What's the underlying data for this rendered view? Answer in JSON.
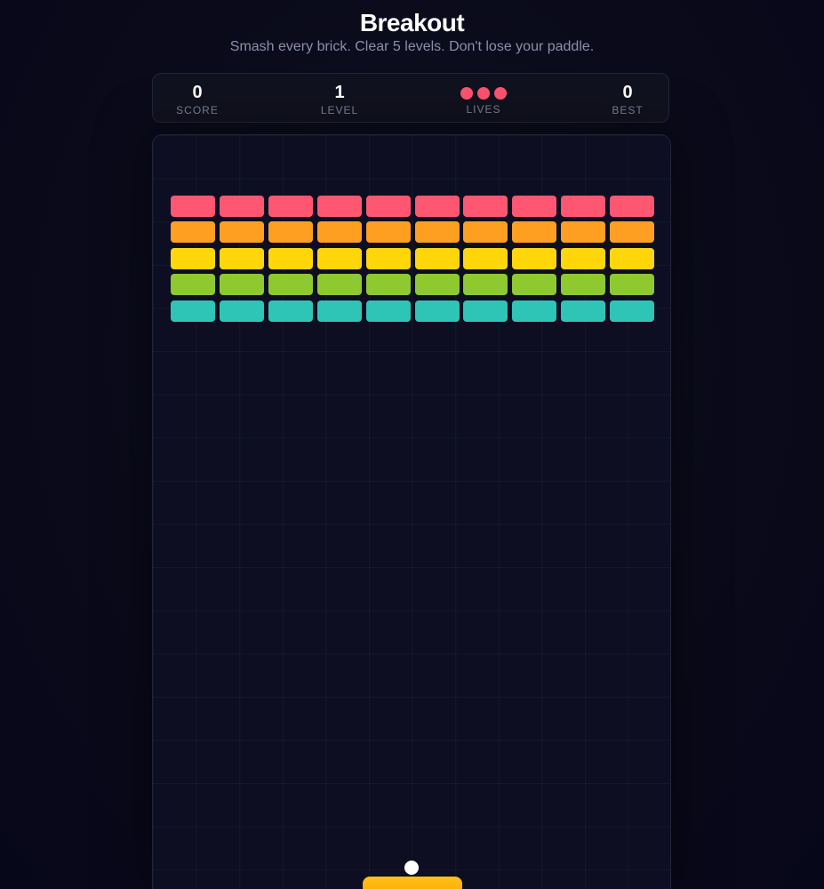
{
  "header": {
    "title": "Breakout",
    "subtitle": "Smash every brick. Clear 5 levels. Don't lose your paddle."
  },
  "hud": {
    "score": {
      "value": "0",
      "label": "SCORE"
    },
    "level": {
      "value": "1",
      "label": "LEVEL"
    },
    "lives": {
      "count": 3,
      "label": "LIVES",
      "color": "#ff5472"
    },
    "best": {
      "value": "0",
      "label": "BEST"
    }
  },
  "board": {
    "brick_columns": 10,
    "brick_rows": [
      {
        "color": "#ff5672"
      },
      {
        "color": "#ff9f22"
      },
      {
        "color": "#ffd60a"
      },
      {
        "color": "#8dc92f"
      },
      {
        "color": "#2ec4b6"
      }
    ],
    "ball_color": "#ffffff",
    "paddle_color": "#ffb60a"
  }
}
